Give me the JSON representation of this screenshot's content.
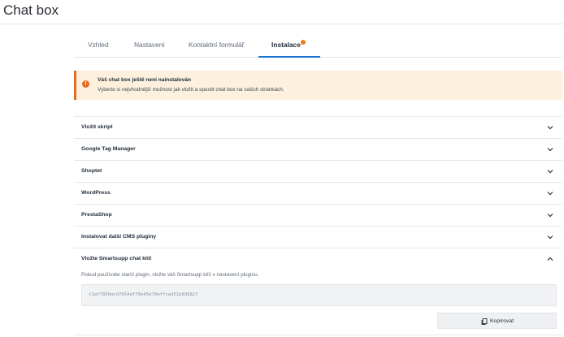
{
  "page": {
    "title": "Chat box"
  },
  "tabs": [
    {
      "label": "Vzhled",
      "active": false
    },
    {
      "label": "Nastavení",
      "active": false
    },
    {
      "label": "Kontaktní formulář",
      "active": false
    },
    {
      "label": "Instalace",
      "active": true,
      "badge": "orange-dot"
    }
  ],
  "alert": {
    "icon": "exclamation-icon",
    "title": "Váš chat box ještě není nainstalován",
    "text": "Vyberte si nejvhodnější možnost jak vložit a spustit chat box na vašich stránkách."
  },
  "accordion": {
    "items": [
      {
        "label": "Vložit skript",
        "expanded": false
      },
      {
        "label": "Google Tag Manager",
        "expanded": false
      },
      {
        "label": "Shoptet",
        "expanded": false
      },
      {
        "label": "WordPress",
        "expanded": false
      },
      {
        "label": "PrestaShop",
        "expanded": false
      },
      {
        "label": "Instalovat další CMS pluginy",
        "expanded": false
      },
      {
        "label": "Vložte Smartsupp chat klíč",
        "expanded": true
      }
    ],
    "expanded_body": {
      "text": "Pokud používáte starší plugin, vložte váš Smartsupp klíč v nastavení pluginu.",
      "key_value": "c1af7850acd7b54df70e45e70effca451b83682f",
      "copy_label": "Kopírovat"
    }
  },
  "colors": {
    "accent": "#1a75d2",
    "warning": "#e46b25",
    "warning_bg": "#fdf1de"
  }
}
